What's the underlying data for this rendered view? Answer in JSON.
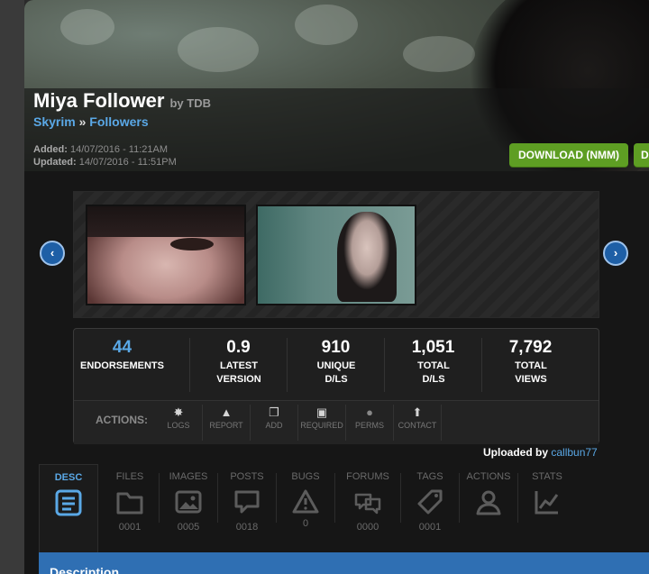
{
  "mod": {
    "title": "Miya Follower",
    "by": "by TDB",
    "breadcrumb": [
      "Skyrim",
      "»",
      "Followers"
    ],
    "added_label": "Added:",
    "added_value": "14/07/2016 - 11:21AM",
    "updated_label": "Updated:",
    "updated_value": "14/07/2016 - 11:51PM"
  },
  "buttons": {
    "download_nmm": "DOWNLOAD (NMM)",
    "download_manual": "D"
  },
  "carousel": {
    "prev": "‹",
    "next": "›"
  },
  "stats": [
    {
      "value": "44",
      "label": "ENDORSEMENTS"
    },
    {
      "value": "0.9",
      "label": "LATEST VERSION"
    },
    {
      "value": "910",
      "label": "UNIQUE D/LS"
    },
    {
      "value": "1,051",
      "label": "TOTAL D/LS"
    },
    {
      "value": "7,792",
      "label": "TOTAL VIEWS"
    }
  ],
  "actions": {
    "label": "ACTIONS:",
    "items": [
      {
        "label": "LOGS",
        "icon": "gear-icon"
      },
      {
        "label": "REPORT",
        "icon": "warning-icon"
      },
      {
        "label": "ADD",
        "icon": "add-icon"
      },
      {
        "label": "REQUIRED",
        "icon": "floppy-icon"
      },
      {
        "label": "PERMS",
        "icon": "permissions-icon"
      },
      {
        "label": "CONTACT",
        "icon": "contact-icon"
      }
    ]
  },
  "uploaded": {
    "label": "Uploaded by",
    "user": "callbun77"
  },
  "tabs": [
    {
      "label": "DESC",
      "count": "",
      "icon": "document-icon"
    },
    {
      "label": "FILES",
      "count": "0001",
      "icon": "folder-icon"
    },
    {
      "label": "IMAGES",
      "count": "0005",
      "icon": "image-icon"
    },
    {
      "label": "POSTS",
      "count": "0018",
      "icon": "speech-bubble-icon"
    },
    {
      "label": "BUGS",
      "count": "0",
      "icon": "warning-icon"
    },
    {
      "label": "FORUMS",
      "count": "0000",
      "icon": "chat-bubbles-icon"
    },
    {
      "label": "TAGS",
      "count": "0001",
      "icon": "tag-icon"
    },
    {
      "label": "ACTIONS",
      "count": "",
      "icon": "user-icon"
    },
    {
      "label": "STATS",
      "count": "",
      "icon": "stats-chart-icon"
    }
  ],
  "section": {
    "title": "Description"
  },
  "colors": {
    "accent_blue": "#5aa8e6",
    "download_green": "#5e9e23",
    "desc_bar": "#2f6fb3"
  }
}
